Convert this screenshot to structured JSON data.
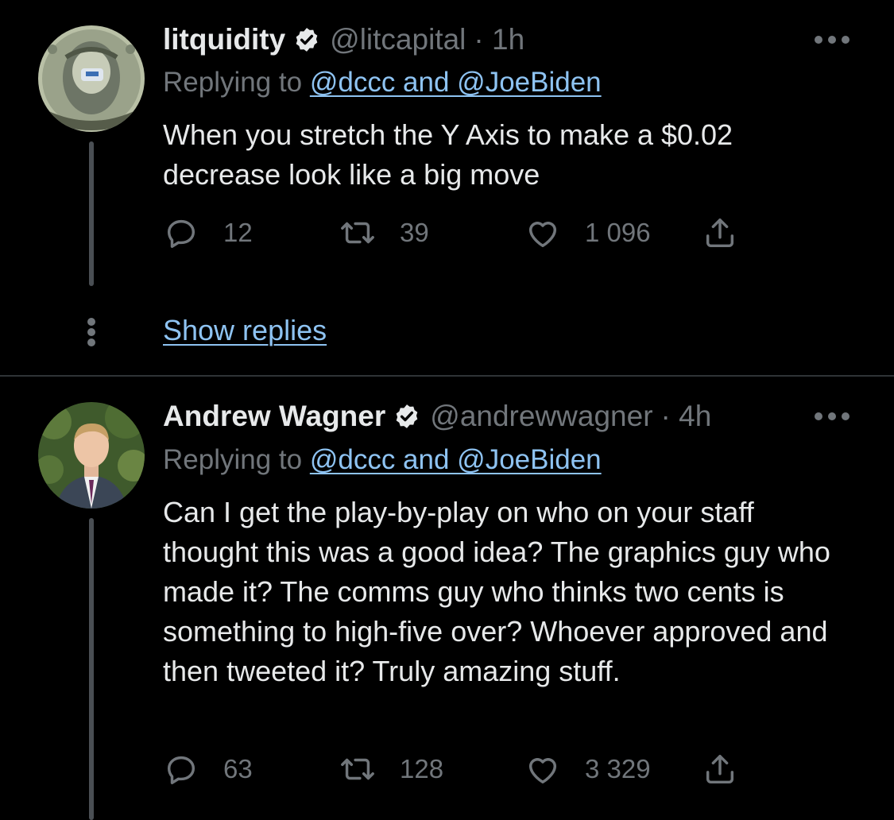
{
  "tweets": [
    {
      "author": {
        "name": "litquidity",
        "handle": "@litcapital",
        "time": "· 1h",
        "verified": true,
        "avatar": "dollar-bill-avatar"
      },
      "replying_prefix": "Replying to ",
      "replying_links": "@dccc and @JoeBiden",
      "text": "When you stretch the Y Axis to make a $0.02 decrease look like a big move",
      "stats": {
        "replies": "12",
        "retweets": "39",
        "likes": "1 096"
      },
      "show_replies": "Show replies"
    },
    {
      "author": {
        "name": "Andrew Wagner",
        "handle": "@andrewwagner",
        "time": "· 4h",
        "verified": true,
        "avatar": "man-in-suit-avatar"
      },
      "replying_prefix": "Replying to ",
      "replying_links": "@dccc and @JoeBiden",
      "text": "Can I get the play-by-play on who on your staff thought this was a good idea? The graphics guy who made it? The comms guy who thinks two cents is something to high-five over? Whoever approved and then tweeted it? Truly amazing stuff.",
      "stats": {
        "replies": "63",
        "retweets": "128",
        "likes": "3 329"
      }
    }
  ],
  "colors": {
    "background": "#000000",
    "text": "#e7e9ea",
    "secondary": "#71767b",
    "link": "#8ec3f2",
    "divider": "#2f3336"
  },
  "icons": [
    "verified-badge-icon",
    "more-icon",
    "reply-icon",
    "retweet-icon",
    "like-icon",
    "share-icon"
  ]
}
